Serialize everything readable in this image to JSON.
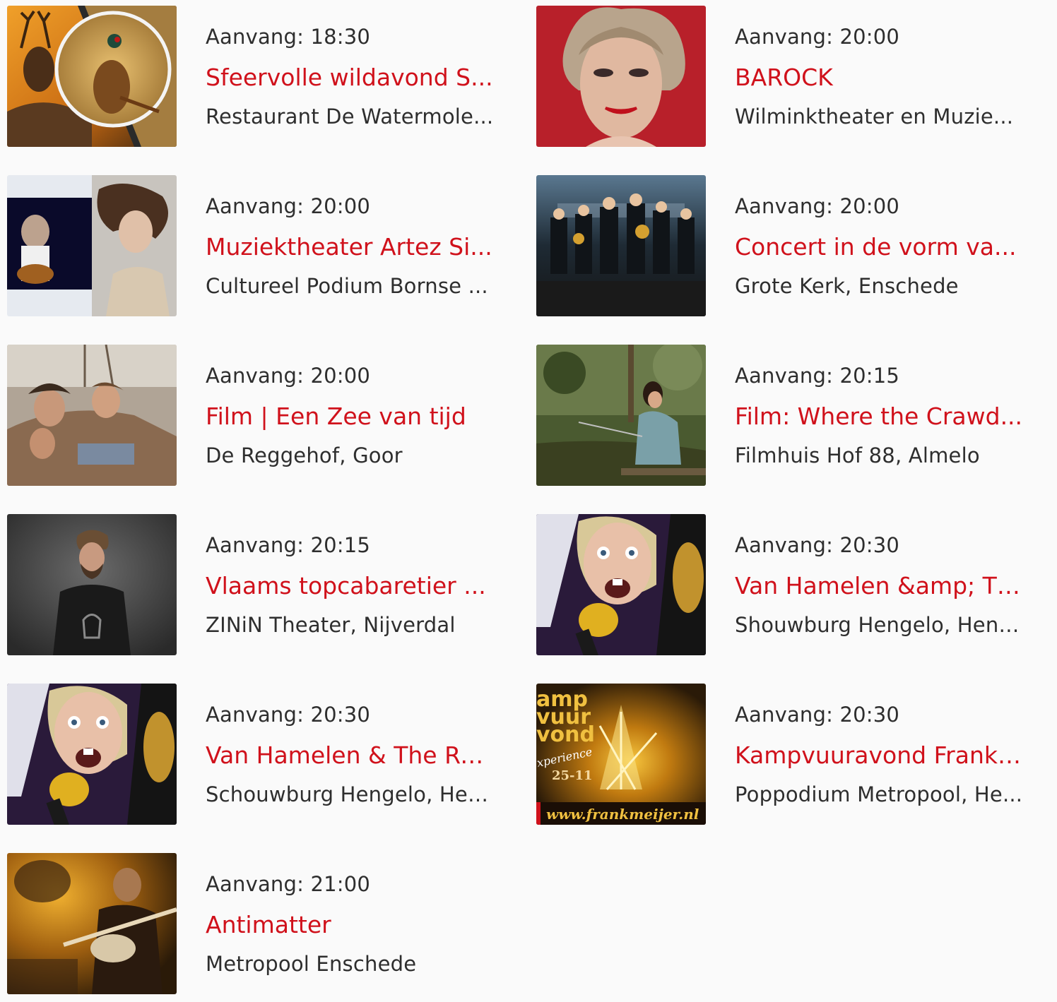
{
  "events": [
    {
      "time": "Aanvang: 18:30",
      "title": "Sfeervolle wildavond S...",
      "venue": "Restaurant De Watermole...",
      "image": "pheasant-and-deer-photo"
    },
    {
      "time": "Aanvang: 20:00",
      "title": "BAROCK",
      "venue": "Wilminktheater en Muzie...",
      "image": "singer-portrait-photo"
    },
    {
      "time": "Aanvang: 20:00",
      "title": "Muziektheater Artez Si...",
      "venue": "Cultureel Podium Bornse ...",
      "image": "guitarist-and-woman-photo"
    },
    {
      "time": "Aanvang: 20:00",
      "title": "Concert in de vorm va...",
      "venue": "Grote Kerk, Enschede",
      "image": "brass-band-photo"
    },
    {
      "time": "Aanvang: 20:00",
      "title": "Film | Een Zee van tijd",
      "venue": "De Reggehof, Goor",
      "image": "family-on-boat-photo"
    },
    {
      "time": "Aanvang: 20:15",
      "title": "Film: Where the Crawd...",
      "venue": "Filmhuis Hof 88, Almelo",
      "image": "girl-fishing-photo"
    },
    {
      "time": "Aanvang: 20:15",
      "title": "Vlaams topcabaretier ...",
      "venue": "ZINiN Theater, Nijverdal",
      "image": "comedian-portrait-photo"
    },
    {
      "time": "Aanvang: 20:30",
      "title": "Van Hamelen &amp; Th...",
      "venue": "Shouwburg Hengelo, Heng...",
      "image": "woman-singing-microphone-photo"
    },
    {
      "time": "Aanvang: 20:30",
      "title": "Van Hamelen & The Rat...",
      "venue": "Schouwburg Hengelo, Hen...",
      "image": "woman-singing-microphone-photo"
    },
    {
      "time": "Aanvang: 20:30",
      "title": "Kampvuuravond Frank ...",
      "venue": "Poppodium Metropool, He...",
      "image": "campfire-poster",
      "poster_text": {
        "line1": "amp",
        "line2": "vuur",
        "line3": "vond",
        "line4": "xperience",
        "date": "25-11",
        "url": "www.frankmeijer.nl"
      }
    },
    {
      "time": "Aanvang: 21:00",
      "title": "Antimatter",
      "venue": "Metropool Enschede",
      "image": "guitarist-on-stage-photo"
    }
  ],
  "colors": {
    "title": "#d0111b",
    "text": "#2e2e2e",
    "background": "#fafafa"
  }
}
